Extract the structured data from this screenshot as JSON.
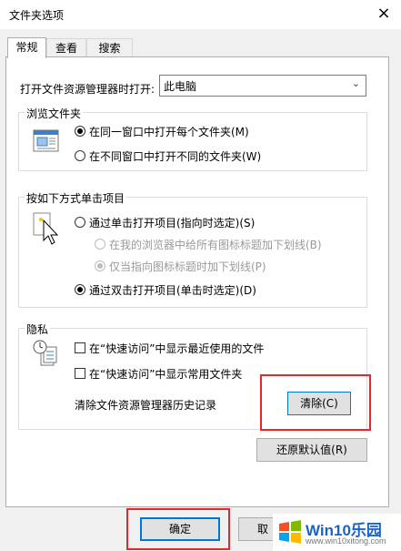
{
  "window": {
    "title": "文件夹选项",
    "close_icon": "×"
  },
  "tabs": [
    {
      "label": "常规",
      "active": true
    },
    {
      "label": "查看"
    },
    {
      "label": "搜索"
    }
  ],
  "open_explorer": {
    "label": "打开文件资源管理器时打开:",
    "value": "此电脑"
  },
  "browse_folders": {
    "title": "浏览文件夹",
    "options": [
      {
        "label": "在同一窗口中打开每个文件夹(M)",
        "selected": true
      },
      {
        "label": "在不同窗口中打开不同的文件夹(W)",
        "selected": false
      }
    ]
  },
  "click_items": {
    "title": "按如下方式单击项目",
    "single": "通过单击打开项目(指向时选定)(S)",
    "sub_options": [
      {
        "label": "在我的浏览器中给所有图标标题加下划线(B)",
        "selected": false
      },
      {
        "label": "仅当指向图标标题时加下划线(P)",
        "selected": true
      }
    ],
    "double": "通过双击打开项目(单击时选定)(D)"
  },
  "privacy": {
    "title": "隐私",
    "recent_files": "在“快速访问”中显示最近使用的文件",
    "frequent_folders": "在“快速访问”中显示常用文件夹",
    "clear_label": "清除文件资源管理器历史记录",
    "clear_button": "清除(C)"
  },
  "restore_button": "还原默认值(R)",
  "footer": {
    "ok": "确定",
    "cancel": "取"
  },
  "watermark": {
    "main": "Win10乐园",
    "sub": "www.win10xitong.com"
  },
  "colors": {
    "accent": "#0078d7",
    "highlight": "#e8252c"
  }
}
